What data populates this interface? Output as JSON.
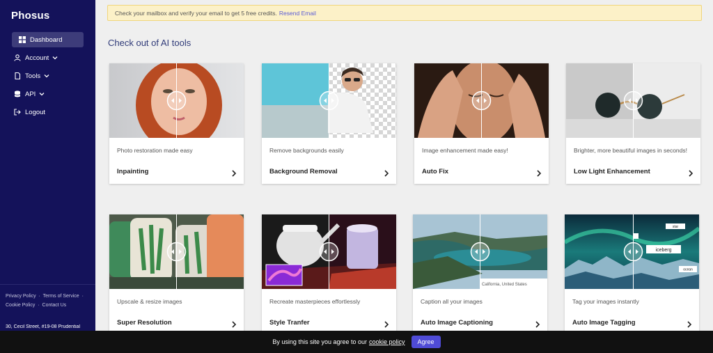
{
  "brand": {
    "logo": "Phosus"
  },
  "sidebar": {
    "items": [
      {
        "label": "Dashboard",
        "icon": "dashboard-icon",
        "active": true
      },
      {
        "label": "Account",
        "icon": "user-icon",
        "has_chevron": true
      },
      {
        "label": "Tools",
        "icon": "document-icon",
        "has_chevron": true
      },
      {
        "label": "API",
        "icon": "database-icon",
        "has_chevron": true
      },
      {
        "label": "Logout",
        "icon": "logout-icon"
      }
    ],
    "footer": {
      "privacy": "Privacy Policy",
      "terms": "Terms of Service",
      "cookie": "Cookie Policy",
      "contact": "Contact Us",
      "address": "30, Cecil Street, #19-08 Prudential"
    }
  },
  "banner": {
    "text": "Check your mailbox and verify your email to get 5 free credits.",
    "link": "Resend Email"
  },
  "main": {
    "heading": "Check out of AI tools",
    "cards": [
      {
        "title": "Inpainting",
        "desc": "Photo restoration made easy"
      },
      {
        "title": "Background Removal",
        "desc": "Remove backgrounds easily"
      },
      {
        "title": "Auto Fix",
        "desc": "Image enhancement made easy!"
      },
      {
        "title": "Low Light Enhancement",
        "desc": "Brighter, more beautiful images in seconds!"
      },
      {
        "title": "Super Resolution",
        "desc": "Upscale & resize images"
      },
      {
        "title": "Style Tranfer",
        "desc": "Recreate masterpieces effortlessly"
      },
      {
        "title": "Auto Image Captioning",
        "desc": "Caption all your images",
        "caption": "California, United States"
      },
      {
        "title": "Auto Image Tagging",
        "desc": "Tag your images instantly",
        "tags": [
          "star",
          "iceberg",
          "ocean"
        ]
      }
    ]
  },
  "cookie_bar": {
    "text": "By using this site you agree to our",
    "link": "cookie policy",
    "button": "Agree"
  },
  "colors": {
    "sidebar": "#14125a",
    "accent": "#4f4bd6",
    "heading": "#2f3a78",
    "banner_bg": "#fcf1c8"
  }
}
